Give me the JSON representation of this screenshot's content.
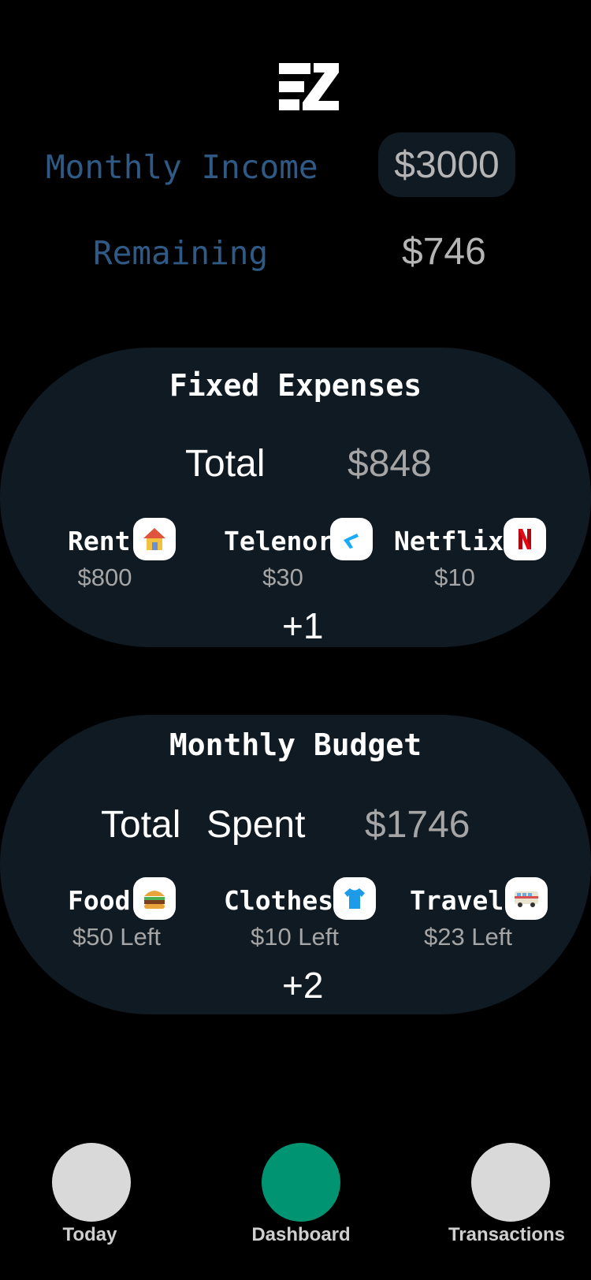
{
  "header": {
    "logo": "EZ"
  },
  "summary": {
    "income_label": "Monthly Income",
    "income_value": "$3000",
    "remaining_label": "Remaining",
    "remaining_value": "$746"
  },
  "fixed_expenses": {
    "title": "Fixed Expenses",
    "total_label": "Total",
    "total_value": "$848",
    "items": [
      {
        "name": "Rent",
        "value": "$800",
        "icon": "house-icon"
      },
      {
        "name": "Telenor",
        "value": "$30",
        "icon": "telenor-logo-icon"
      },
      {
        "name": "Netflix",
        "value": "$10",
        "icon": "netflix-logo-icon"
      }
    ],
    "more": "+1"
  },
  "monthly_budget": {
    "title": "Monthly Budget",
    "total_label_1": "Total",
    "total_label_2": "Spent",
    "total_value": "$1746",
    "items": [
      {
        "name": "Food",
        "value": "$50 Left",
        "icon": "burger-icon"
      },
      {
        "name": "Clothes",
        "value": "$10 Left",
        "icon": "tshirt-icon"
      },
      {
        "name": "Travel",
        "value": "$23 Left",
        "icon": "bus-icon"
      }
    ],
    "more": "+2"
  },
  "nav": {
    "items": [
      {
        "label": "Today",
        "active": false
      },
      {
        "label": "Dashboard",
        "active": true
      },
      {
        "label": "Transactions",
        "active": false
      }
    ],
    "active_color": "#009473",
    "inactive_color": "#d9d9d9"
  },
  "colors": {
    "background": "#000000",
    "card": "#0f1a23",
    "label_blue": "#2f5a85"
  }
}
